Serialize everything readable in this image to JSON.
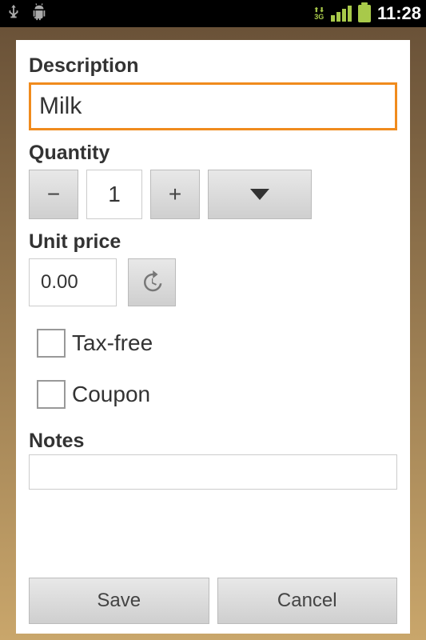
{
  "status": {
    "network_label": "3G",
    "time": "11:28"
  },
  "form": {
    "description_label": "Description",
    "description_value": "Milk",
    "quantity_label": "Quantity",
    "quantity_value": "1",
    "minus": "−",
    "plus": "+",
    "unit_price_label": "Unit price",
    "unit_price_value": "0.00",
    "tax_free_label": "Tax-free",
    "coupon_label": "Coupon",
    "notes_label": "Notes",
    "notes_value": ""
  },
  "buttons": {
    "save": "Save",
    "cancel": "Cancel"
  }
}
